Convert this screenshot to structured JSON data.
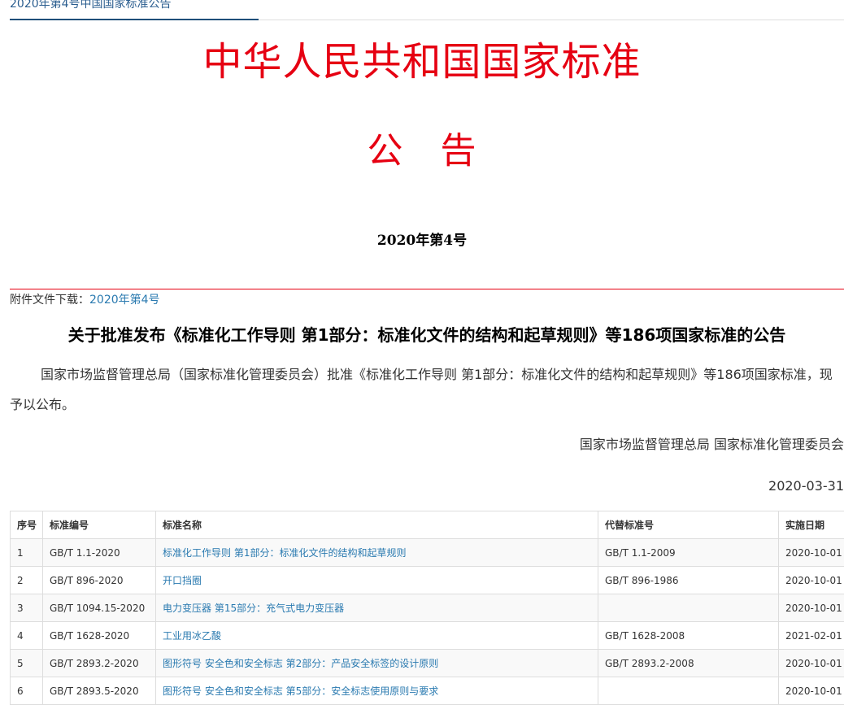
{
  "breadcrumb": {
    "current": "2020年第4号中国国家标准公告"
  },
  "header": {
    "title": "中华人民共和国国家标准",
    "announcement": "公　告",
    "number": "2020年第4号"
  },
  "attachment": {
    "label": "附件文件下载：",
    "link": "2020年第4号"
  },
  "notice": {
    "title": "关于批准发布《标准化工作导则 第1部分：标准化文件的结构和起草规则》等186项国家标准的公告",
    "body": "国家市场监督管理总局（国家标准化管理委员会）批准《标准化工作导则 第1部分：标准化文件的结构和起草规则》等186项国家标准，现予以公布。",
    "signature": "国家市场监督管理总局 国家标准化管理委员会",
    "date": "2020-03-31"
  },
  "table": {
    "headers": [
      "序号",
      "标准编号",
      "标准名称",
      "代替标准号",
      "实施日期"
    ],
    "rows": [
      {
        "seq": "1",
        "code": "GB/T 1.1-2020",
        "name": "标准化工作导则 第1部分：标准化文件的结构和起草规则",
        "replaces": "GB/T 1.1-2009",
        "date": "2020-10-01"
      },
      {
        "seq": "2",
        "code": "GB/T 896-2020",
        "name": "开口挡圈",
        "replaces": "GB/T 896-1986",
        "date": "2020-10-01"
      },
      {
        "seq": "3",
        "code": "GB/T 1094.15-2020",
        "name": "电力变压器 第15部分：充气式电力变压器",
        "replaces": "",
        "date": "2020-10-01"
      },
      {
        "seq": "4",
        "code": "GB/T 1628-2020",
        "name": "工业用冰乙酸",
        "replaces": "GB/T 1628-2008",
        "date": "2021-02-01"
      },
      {
        "seq": "5",
        "code": "GB/T 2893.2-2020",
        "name": "图形符号 安全色和安全标志 第2部分：产品安全标签的设计原则",
        "replaces": "GB/T 2893.2-2008",
        "date": "2020-10-01"
      },
      {
        "seq": "6",
        "code": "GB/T 2893.5-2020",
        "name": "图形符号 安全色和安全标志 第5部分：安全标志使用原则与要求",
        "replaces": "",
        "date": "2020-10-01"
      }
    ]
  }
}
